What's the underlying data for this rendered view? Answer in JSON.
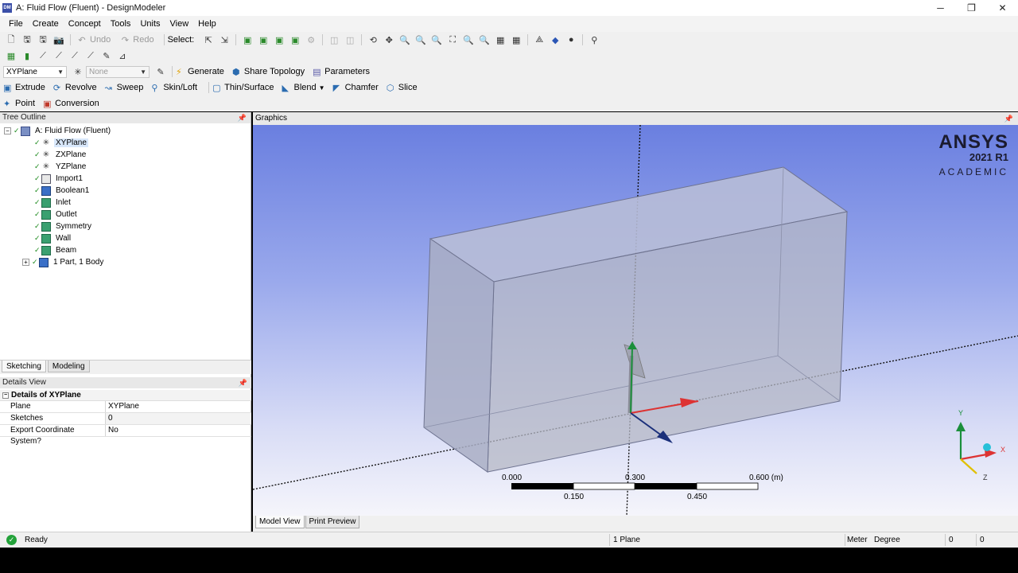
{
  "window": {
    "app_icon_text": "DM",
    "title": "A: Fluid Flow (Fluent) - DesignModeler",
    "minimize": "─",
    "restore": "❐",
    "close": "✕"
  },
  "menu": [
    "File",
    "Create",
    "Concept",
    "Tools",
    "Units",
    "View",
    "Help"
  ],
  "toolbar1": {
    "undo": "Undo",
    "redo": "Redo",
    "select": "Select:"
  },
  "toolbar3": {
    "plane_combo": "XYPlane",
    "sketch_combo": "None",
    "generate": "Generate",
    "share_topology": "Share Topology",
    "parameters": "Parameters"
  },
  "toolbar4": {
    "extrude": "Extrude",
    "revolve": "Revolve",
    "sweep": "Sweep",
    "skinloft": "Skin/Loft",
    "thinsurface": "Thin/Surface",
    "blend": "Blend",
    "chamfer": "Chamfer",
    "slice": "Slice"
  },
  "toolbar5": {
    "point": "Point",
    "conversion": "Conversion"
  },
  "tree": {
    "header": "Tree Outline",
    "root": "A: Fluid Flow (Fluent)",
    "items": [
      {
        "label": "XYPlane",
        "icon": "plane-axes-icon",
        "selected": true
      },
      {
        "label": "ZXPlane",
        "icon": "plane-axes-icon"
      },
      {
        "label": "YZPlane",
        "icon": "plane-axes-icon"
      },
      {
        "label": "Import1",
        "icon": "import-icon"
      },
      {
        "label": "Boolean1",
        "icon": "boolean-icon"
      },
      {
        "label": "Inlet",
        "icon": "named-selection-icon"
      },
      {
        "label": "Outlet",
        "icon": "named-selection-icon"
      },
      {
        "label": "Symmetry",
        "icon": "named-selection-icon"
      },
      {
        "label": "Wall",
        "icon": "named-selection-icon"
      },
      {
        "label": "Beam",
        "icon": "named-selection-icon"
      },
      {
        "label": "1 Part, 1 Body",
        "icon": "parts-icon"
      }
    ]
  },
  "tabs": [
    "Sketching",
    "Modeling"
  ],
  "details": {
    "header": "Details View",
    "title": "Details of XYPlane",
    "rows": [
      {
        "key": "Plane",
        "value": "XYPlane"
      },
      {
        "key": "Sketches",
        "value": "0"
      },
      {
        "key": "Export Coordinate System?",
        "value": "No"
      }
    ]
  },
  "graphics": {
    "header": "Graphics",
    "logo": {
      "brand": "ANSYS",
      "version": "2021 R1",
      "edition": "ACADEMIC"
    },
    "scale": {
      "top_labels": [
        "0.000",
        "0.300",
        "0.600 (m)"
      ],
      "bottom_labels": [
        "0.150",
        "0.450"
      ]
    },
    "triad": {
      "x": "X",
      "y": "Y",
      "z": "Z"
    }
  },
  "view_tabs": [
    "Model View",
    "Print Preview"
  ],
  "status": {
    "ready": "Ready",
    "selection": "1 Plane",
    "units_length": "Meter",
    "units_angle": "Degree",
    "coord1": "0",
    "coord2": "0"
  },
  "colors": {
    "viewport_top": "#6a7fe0",
    "viewport_bottom": "#f5f5fb",
    "tree_check": "#1d8a1d",
    "status_ok": "#23a23a"
  }
}
